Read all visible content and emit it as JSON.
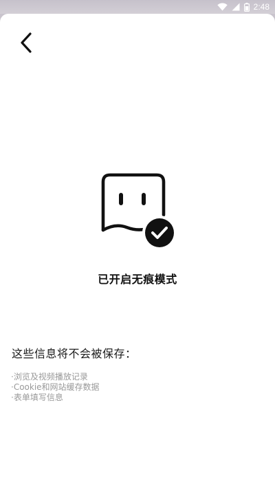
{
  "status_bar": {
    "time": "2:48",
    "icons": [
      "wifi-icon",
      "signal-icon",
      "battery-icon"
    ]
  },
  "header": {
    "back_icon": "chevron-left-icon"
  },
  "hero": {
    "icon": "ghost-check-icon",
    "title": "已开启无痕模式"
  },
  "info": {
    "title": "这些信息将不会被保存：",
    "items": [
      "·浏览及视频播放记录",
      "·Cookie和网站缓存数据",
      "·表单填写信息"
    ]
  },
  "colors": {
    "status_bar_bg": "#c6c1cb",
    "page_bg": "#ffffff",
    "primary_text": "#111111",
    "secondary_text": "#999999"
  }
}
